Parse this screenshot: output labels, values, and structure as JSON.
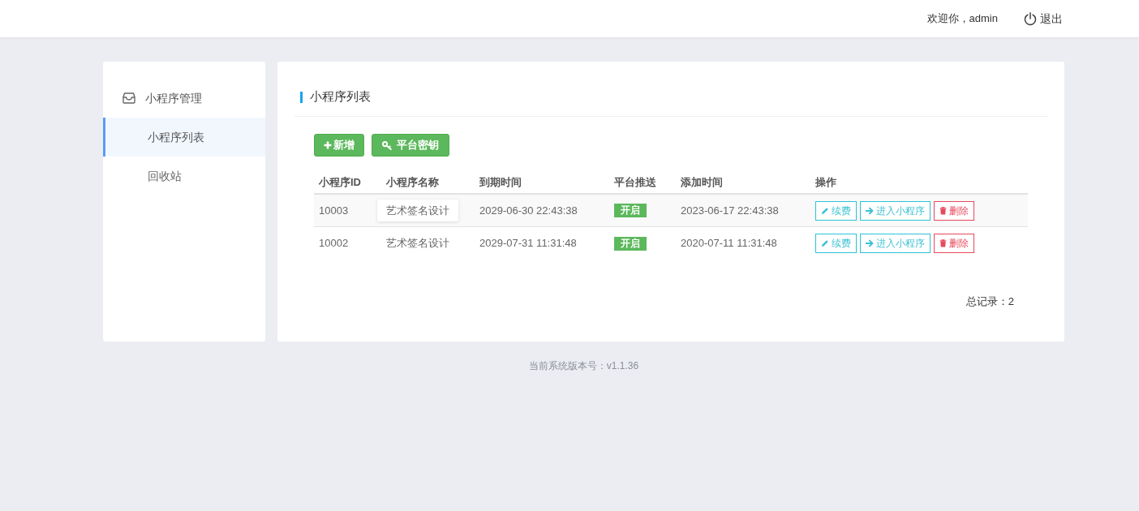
{
  "header": {
    "greeting": "欢迎你，admin",
    "logout": "退出"
  },
  "sidebar": {
    "group": {
      "label": "小程序管理",
      "items": [
        {
          "label": "小程序列表",
          "selected": true
        },
        {
          "label": "回收站",
          "selected": false
        }
      ]
    }
  },
  "panel": {
    "title": "小程序列表",
    "toolbar": [
      {
        "kind": "add",
        "label": "新增"
      },
      {
        "kind": "key",
        "label": "平台密钥"
      }
    ],
    "table": {
      "columns": [
        "小程序ID",
        "小程序名称",
        "到期时间",
        "平台推送",
        "添加时间",
        "操作"
      ],
      "rows": [
        {
          "id": "10003",
          "name": "艺术签名设计",
          "highlighted": true,
          "expires": "2029-06-30 22:43:38",
          "push": {
            "label": "开启",
            "on": true
          },
          "added": "2023-06-17 22:43:38",
          "actions": [
            {
              "kind": "renew",
              "label": "续费"
            },
            {
              "kind": "enter",
              "label": "进入小程序"
            },
            {
              "kind": "delete",
              "label": "删除"
            }
          ]
        },
        {
          "id": "10002",
          "name": "艺术签名设计",
          "highlighted": false,
          "expires": "2029-07-31 11:31:48",
          "push": {
            "label": "开启",
            "on": true
          },
          "added": "2020-07-11 11:31:48",
          "actions": [
            {
              "kind": "renew",
              "label": "续费"
            },
            {
              "kind": "enter",
              "label": "进入小程序"
            },
            {
              "kind": "delete",
              "label": "删除"
            }
          ]
        }
      ]
    },
    "total": "总记录：2"
  },
  "footer": {
    "version": "当前系统版本号：v1.1.36"
  }
}
